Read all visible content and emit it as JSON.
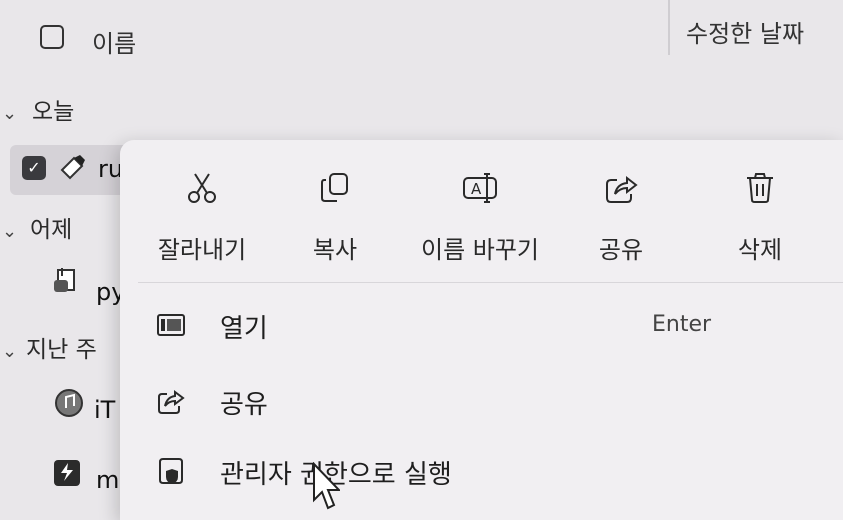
{
  "header": {
    "name_label": "이름",
    "date_label": "수정한 날짜"
  },
  "groups": {
    "today": "오늘",
    "yesterday": "어제",
    "last_week": "지난 주"
  },
  "files": [
    {
      "name": "ru",
      "icon": "script-file-icon"
    },
    {
      "name": "py",
      "icon": "python-file-icon"
    },
    {
      "name": "iT",
      "icon": "itunes-file-icon"
    },
    {
      "name": "m",
      "icon": "zip-file-icon"
    }
  ],
  "menu": {
    "actions": [
      {
        "label": "잘라내기",
        "icon": "cut-icon"
      },
      {
        "label": "복사",
        "icon": "copy-icon"
      },
      {
        "label": "이름 바꾸기",
        "icon": "rename-icon"
      },
      {
        "label": "공유",
        "icon": "share-icon"
      },
      {
        "label": "삭제",
        "icon": "trash-icon"
      }
    ],
    "items": [
      {
        "label": "열기",
        "shortcut": "Enter",
        "icon": "open-icon"
      },
      {
        "label": "공유",
        "icon": "share-icon"
      },
      {
        "label": "관리자 권한으로 실행",
        "icon": "shield-icon"
      }
    ]
  }
}
